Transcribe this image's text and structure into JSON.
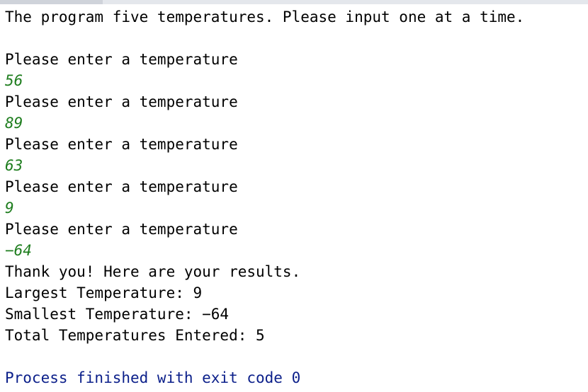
{
  "console": {
    "colors": {
      "output": "#000000",
      "user_input": "#1e7d1e",
      "process": "#0b1f8a"
    },
    "lines": [
      {
        "kind": "output",
        "text": "The program five temperatures. Please input one at a time."
      },
      {
        "kind": "blank",
        "text": ""
      },
      {
        "kind": "output",
        "text": "Please enter a temperature"
      },
      {
        "kind": "input",
        "text": "56"
      },
      {
        "kind": "output",
        "text": "Please enter a temperature"
      },
      {
        "kind": "input",
        "text": "89"
      },
      {
        "kind": "output",
        "text": "Please enter a temperature"
      },
      {
        "kind": "input",
        "text": "63"
      },
      {
        "kind": "output",
        "text": "Please enter a temperature"
      },
      {
        "kind": "input",
        "text": "9"
      },
      {
        "kind": "output",
        "text": "Please enter a temperature"
      },
      {
        "kind": "input",
        "text": "−64"
      },
      {
        "kind": "output",
        "text": "Thank you! Here are your results."
      },
      {
        "kind": "output",
        "text": "Largest Temperature: 9"
      },
      {
        "kind": "output",
        "text": "Smallest Temperature: −64"
      },
      {
        "kind": "output",
        "text": "Total Temperatures Entered: 5"
      },
      {
        "kind": "blank",
        "text": ""
      },
      {
        "kind": "process",
        "text": "Process finished with exit code 0"
      }
    ]
  }
}
